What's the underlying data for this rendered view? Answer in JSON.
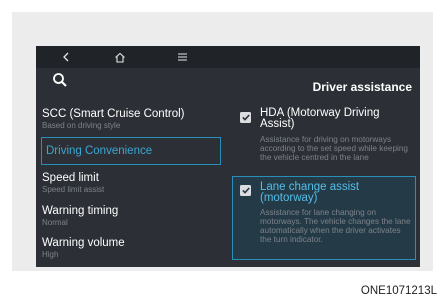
{
  "screen": {
    "title": "Driver assistance",
    "topbar": {
      "back_icon": "chevron-left-icon",
      "home_icon": "home-icon",
      "menu_icon": "menu-icon"
    },
    "search_icon": "search-icon",
    "menu": [
      {
        "label": "SCC (Smart Cruise Control)",
        "sub": "Based on driving style"
      },
      {
        "label": "Driving Convenience",
        "sub": "",
        "selected": true
      },
      {
        "label": "Speed limit",
        "sub": "Speed limit assist"
      },
      {
        "label": "Warning timing",
        "sub": "Normal"
      },
      {
        "label": "Warning volume",
        "sub": "High"
      }
    ],
    "options": [
      {
        "label": "HDA (Motorway Driving Assist)",
        "desc": "Assistance for driving on motorways according to the set speed while keeping the vehicle centred in the lane",
        "checked": true
      },
      {
        "label": "Lane change assist (motorway)",
        "desc": "Assistance for lane changing on motorways. The vehicle changes the lane automatically when the driver activates the turn indicator.",
        "checked": true,
        "selected": true
      }
    ],
    "colors": {
      "screen_bg": "#2c3036",
      "accent": "#2a8fb8",
      "accent_text": "#3aa7d3",
      "muted_text": "#7d828a"
    }
  },
  "caption": "ONE1071213L"
}
